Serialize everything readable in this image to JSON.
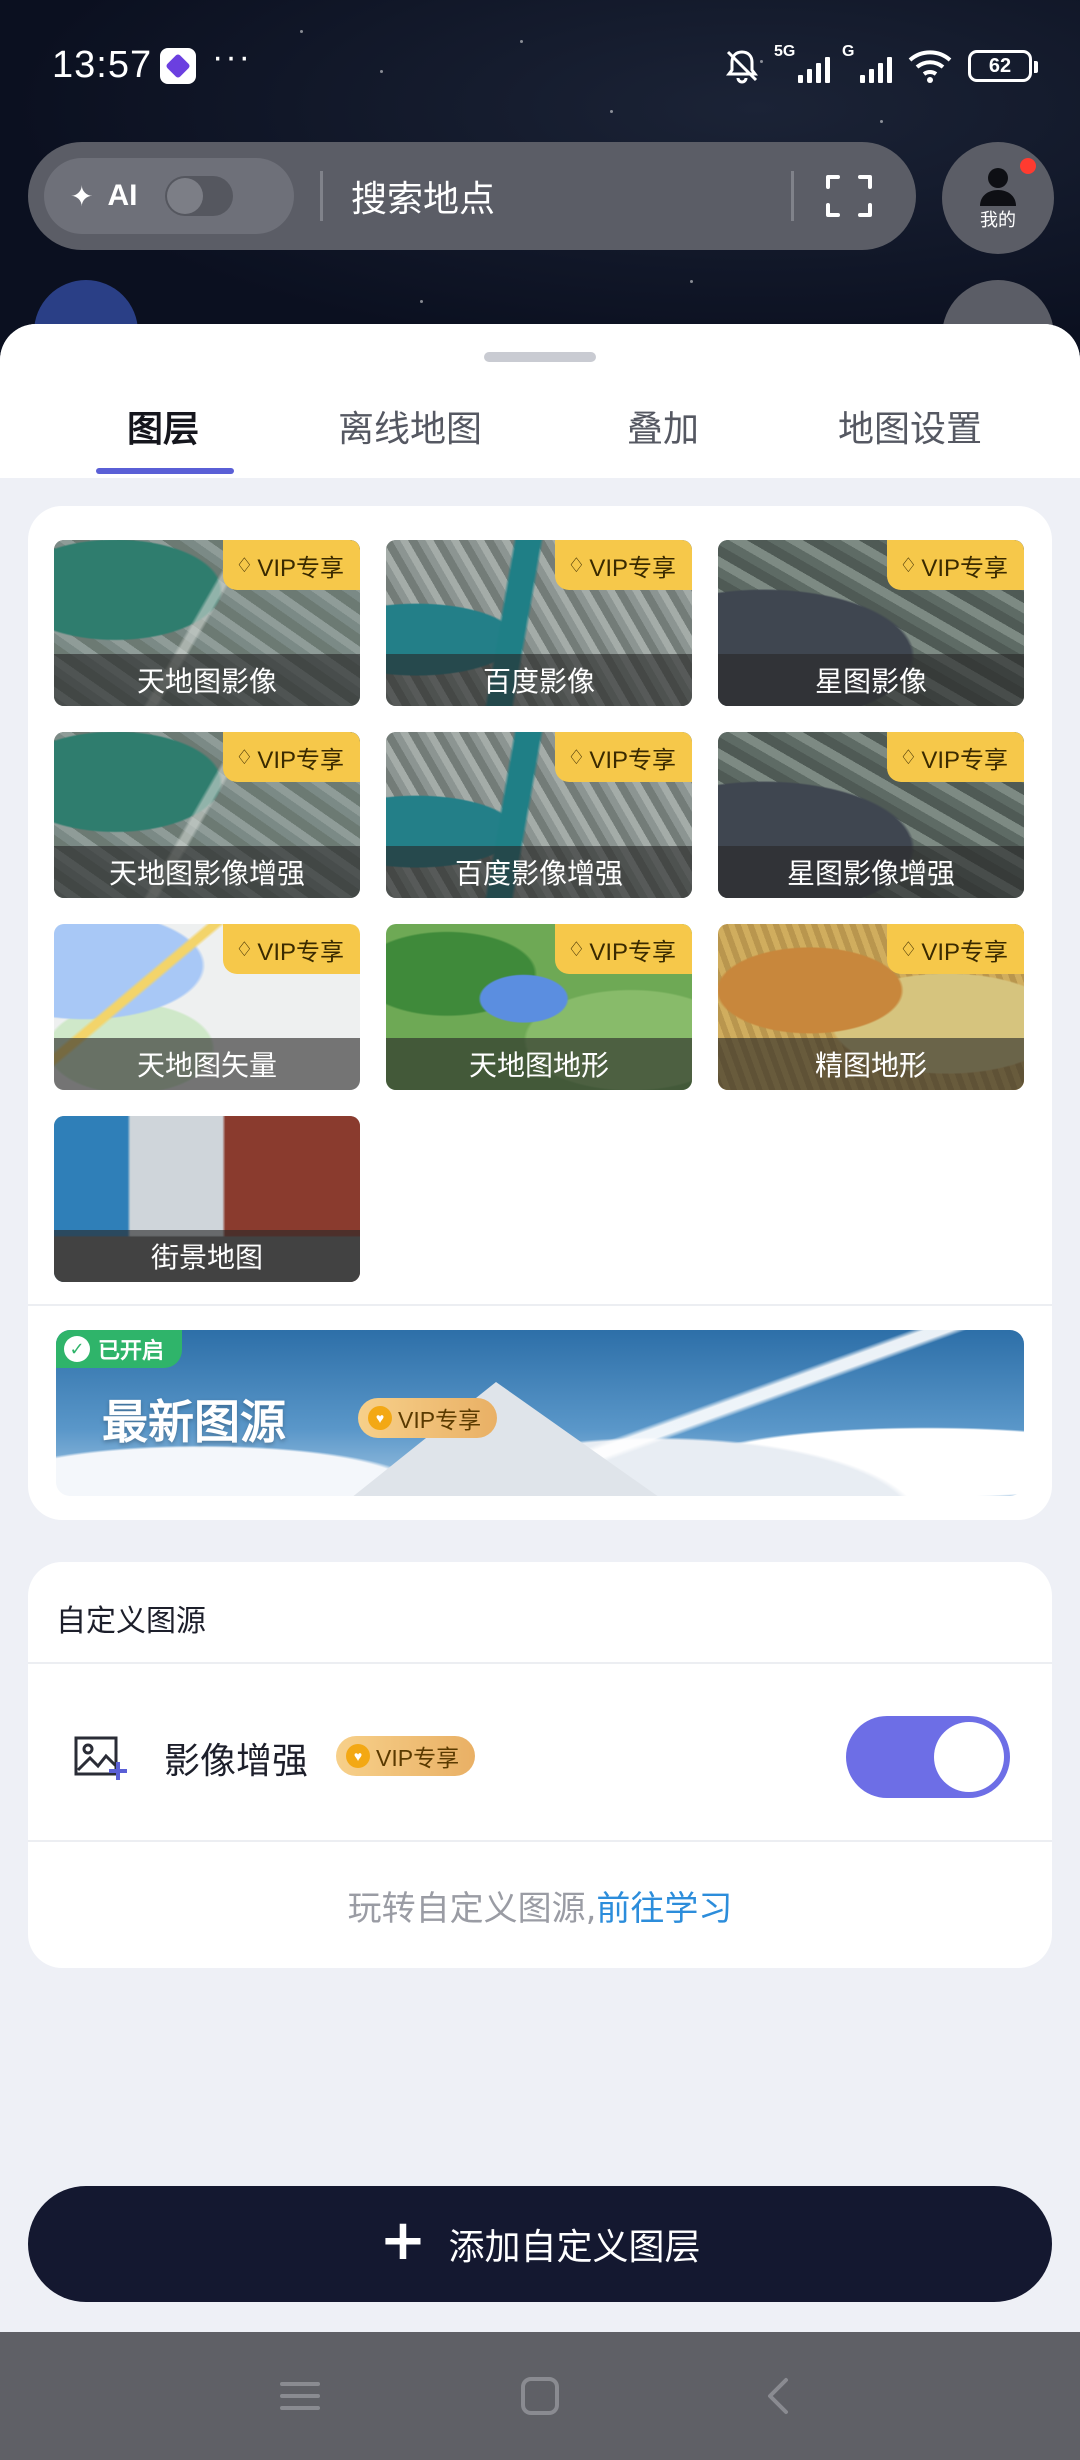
{
  "status_bar": {
    "time": "13:57",
    "network_label_1": "5G",
    "network_label_2": "G",
    "battery": "62"
  },
  "top_bar": {
    "ai_label": "AI",
    "search_placeholder": "搜索地点",
    "profile_label": "我的"
  },
  "tabs": [
    {
      "label": "图层",
      "active": true
    },
    {
      "label": "离线地图",
      "active": false
    },
    {
      "label": "叠加",
      "active": false
    },
    {
      "label": "地图设置",
      "active": false
    }
  ],
  "vip_badge": "VIP专享",
  "layers": [
    {
      "label": "天地图影像",
      "vip": true,
      "style": "img-sat"
    },
    {
      "label": "百度影像",
      "vip": true,
      "style": "img-baidu"
    },
    {
      "label": "星图影像",
      "vip": true,
      "style": "img-star"
    },
    {
      "label": "天地图影像增强",
      "vip": true,
      "style": "img-sat"
    },
    {
      "label": "百度影像增强",
      "vip": true,
      "style": "img-baidu"
    },
    {
      "label": "星图影像增强",
      "vip": true,
      "style": "img-star"
    },
    {
      "label": "天地图矢量",
      "vip": true,
      "style": "img-vec"
    },
    {
      "label": "天地图地形",
      "vip": true,
      "style": "img-terrain"
    },
    {
      "label": "精图地形",
      "vip": true,
      "style": "img-jingtu"
    },
    {
      "label": "街景地图",
      "vip": false,
      "style": "img-street"
    }
  ],
  "banner": {
    "status": "已开启",
    "title": "最新图源",
    "vip": "VIP专享"
  },
  "custom_source": {
    "title": "自定义图源",
    "enhance_label": "影像增强",
    "enhance_vip": "VIP专享",
    "enhance_on": true,
    "learn_text": "玩转自定义图源,",
    "learn_link": "前往学习"
  },
  "add_button": "添加自定义图层",
  "icons": {
    "notifications_muted": "bell-off-icon",
    "scan": "scan-icon",
    "profile": "person-icon",
    "image_plus": "image-plus-icon",
    "nav_menu": "menu-icon",
    "nav_home": "home-square-icon",
    "nav_back": "back-icon"
  },
  "colors": {
    "accent": "#5a5fd6",
    "switch_on": "#6d6ee6",
    "vip_gold": "#f6c84a",
    "link": "#2c8ddb",
    "button_dark": "#141830"
  }
}
